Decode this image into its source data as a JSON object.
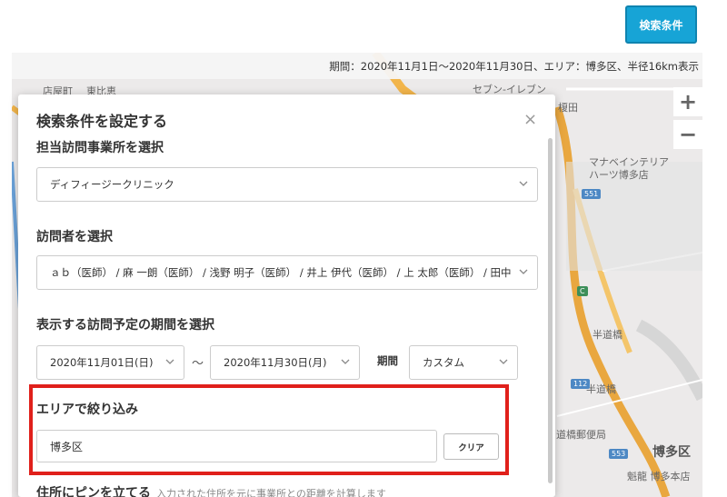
{
  "header": {
    "search_button_label": "検索条件"
  },
  "info_bar": {
    "text": "期間：2020年11月1日〜2020年11月30日、エリア：博多区、半径16km表示"
  },
  "map": {
    "zoom_in": "+",
    "zoom_out": "−",
    "labels": {
      "seven": "セブン-イレブン",
      "store_left": "店屋町",
      "store_left2": "東比恵",
      "umeda": "榎田",
      "manabe1": "マナベインテリア",
      "manabe2": "ハーツ博多店",
      "hanmichibashi": "半道橋",
      "hanmichibashi2": "半道橋",
      "post1": "道橋郵便局",
      "hakata_ku": "博多区",
      "kaikan": "魁龍 博多本店"
    },
    "badges": {
      "r551": "551",
      "r112": "112",
      "r553": "553",
      "c": "C"
    }
  },
  "modal": {
    "title": "検索条件を設定する",
    "close": "×",
    "office_label": "担当訪問事業所を選択",
    "office_value": "ディフィージークリニック",
    "visitor_label": "訪問者を選択",
    "visitor_value": "ａｂ（医師） / 麻 一朗（医師） / 浅野 明子（医師） / 井上 伊代（医師） / 上 太郎（医師） / 田中",
    "period_label": "表示する訪問予定の期間を選択",
    "start_date": "2020年11月01日(日)",
    "tilde": "〜",
    "end_date": "2020年11月30日(月)",
    "period_type_label": "期間",
    "period_type_value": "カスタム",
    "area_label": "エリアで絞り込み",
    "area_value": "博多区",
    "clear_label": "クリア",
    "pin_label": "住所にピンを立てる",
    "pin_sub": "入力された住所を元に事業所との距離を計算します"
  },
  "colors": {
    "accent": "#17a4d6",
    "highlight": "#e0201b"
  }
}
